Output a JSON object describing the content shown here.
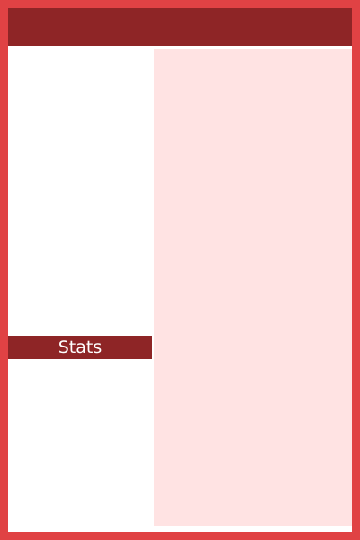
{
  "header": {
    "title": ""
  },
  "sidebar": {
    "items": [
      {
        "label": "Stats",
        "selected": true
      }
    ]
  },
  "colors": {
    "border": "#e04244",
    "accent_dark": "#8e2526",
    "panel": "#ffe3e3",
    "background": "#ffffff",
    "text_on_accent": "#ffffff"
  }
}
